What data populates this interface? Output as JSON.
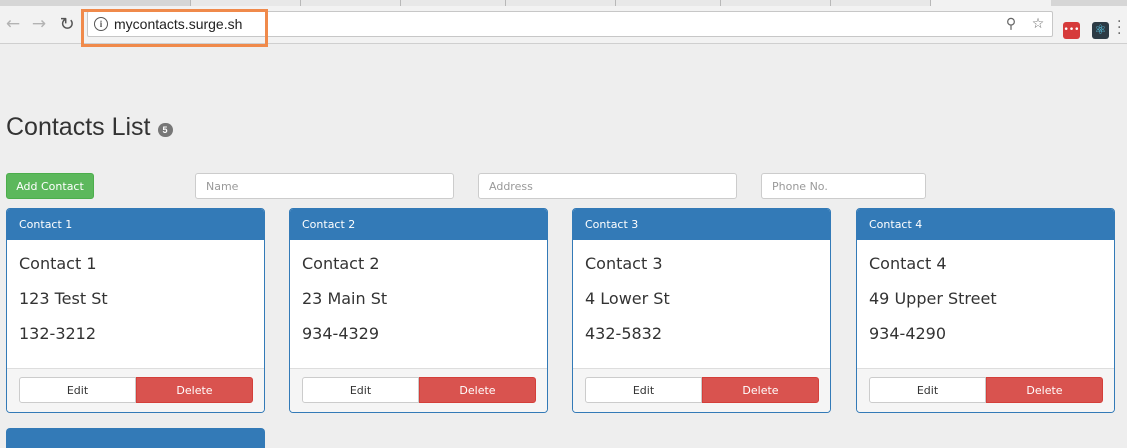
{
  "browser": {
    "url": "mycontacts.surge.sh",
    "icons": {
      "back": "arrow-left-icon",
      "forward": "arrow-right-icon",
      "reload": "reload-icon",
      "info": "info-icon",
      "zoom": "zoom-icon",
      "bookmark": "star-icon"
    },
    "extension_red_label": "•••",
    "highlight_color": "#f08a4b"
  },
  "page": {
    "title": "Contacts List",
    "count": "5",
    "add_button": "Add Contact",
    "inputs": {
      "name_placeholder": "Name",
      "address_placeholder": "Address",
      "phone_placeholder": "Phone No."
    }
  },
  "contacts": [
    {
      "header": "Contact 1",
      "name": "Contact 1",
      "address": "123 Test St",
      "phone": "132-3212"
    },
    {
      "header": "Contact 2",
      "name": "Contact 2",
      "address": "23 Main St",
      "phone": "934-4329"
    },
    {
      "header": "Contact 3",
      "name": "Contact 3",
      "address": "4 Lower St",
      "phone": "432-5832"
    },
    {
      "header": "Contact 4",
      "name": "Contact 4",
      "address": "49 Upper Street",
      "phone": "934-4290"
    }
  ],
  "actions": {
    "edit": "Edit",
    "delete": "Delete"
  },
  "colors": {
    "primary": "#337ab7",
    "success": "#5cb85c",
    "danger": "#d9534f"
  }
}
